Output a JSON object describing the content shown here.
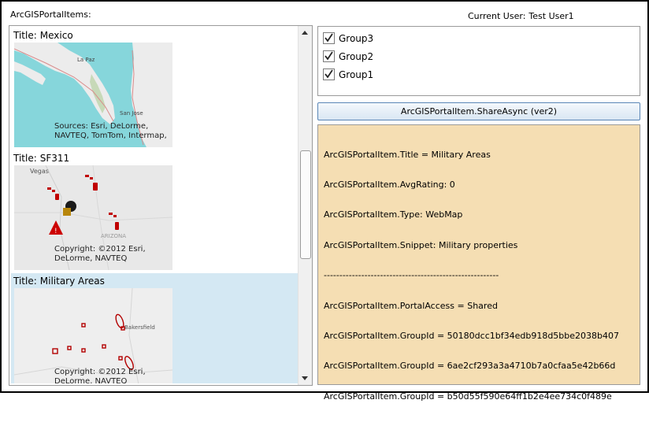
{
  "header": {
    "label": "ArcGISPortalItems:"
  },
  "current_user": {
    "label": "Current User:",
    "name": "Test User1"
  },
  "portal_items": [
    {
      "title_label": "Title:",
      "title": "Mexico",
      "credit": "Sources: Esri, DeLorme, NAVTEQ, TomTom, Intermap,",
      "map_labels": [
        "La Paz",
        "San Jose"
      ]
    },
    {
      "title_label": "Title:",
      "title": "SF311",
      "credit": "Copyright: ©2012 Esri, DeLorme, NAVTEQ",
      "map_labels": [
        "Vegas",
        "ARIZONA"
      ]
    },
    {
      "title_label": "Title:",
      "title": "Military Areas",
      "credit": "Copyright: ©2012 Esri, DeLorme, NAVTEQ",
      "map_labels": [
        "Bakersfield"
      ]
    }
  ],
  "groups": [
    {
      "label": "Group3",
      "checked": true
    },
    {
      "label": "Group2",
      "checked": true
    },
    {
      "label": "Group1",
      "checked": true
    }
  ],
  "share_button": {
    "label": "ArcGISPortalItem.ShareAsync (ver2)"
  },
  "output_lines": [
    "ArcGISPortalItem.Title = Military Areas",
    "ArcGISPortalItem.AvgRating: 0",
    "ArcGISPortalItem.Type: WebMap",
    "ArcGISPortalItem.Snippet: Military properties",
    "--------------------------------------------------------",
    "ArcGISPortalItem.PortalAccess = Shared",
    "ArcGISPortalItem.GroupId = 50180dcc1bf34edb918d5bbe2038b407",
    "ArcGISPortalItem.GroupId = 6ae2cf293a3a4710b7a0cfaa5e42b66d",
    "ArcGISPortalItem.GroupId = b50d55f590e64ff1b2e4ee734c0f489e"
  ],
  "colors": {
    "output_background": "#f5deb3",
    "selected_item": "#d4e8f3",
    "ocean": "#86d6db",
    "land": "#e9e9e9",
    "military_marker": "#b30000"
  }
}
